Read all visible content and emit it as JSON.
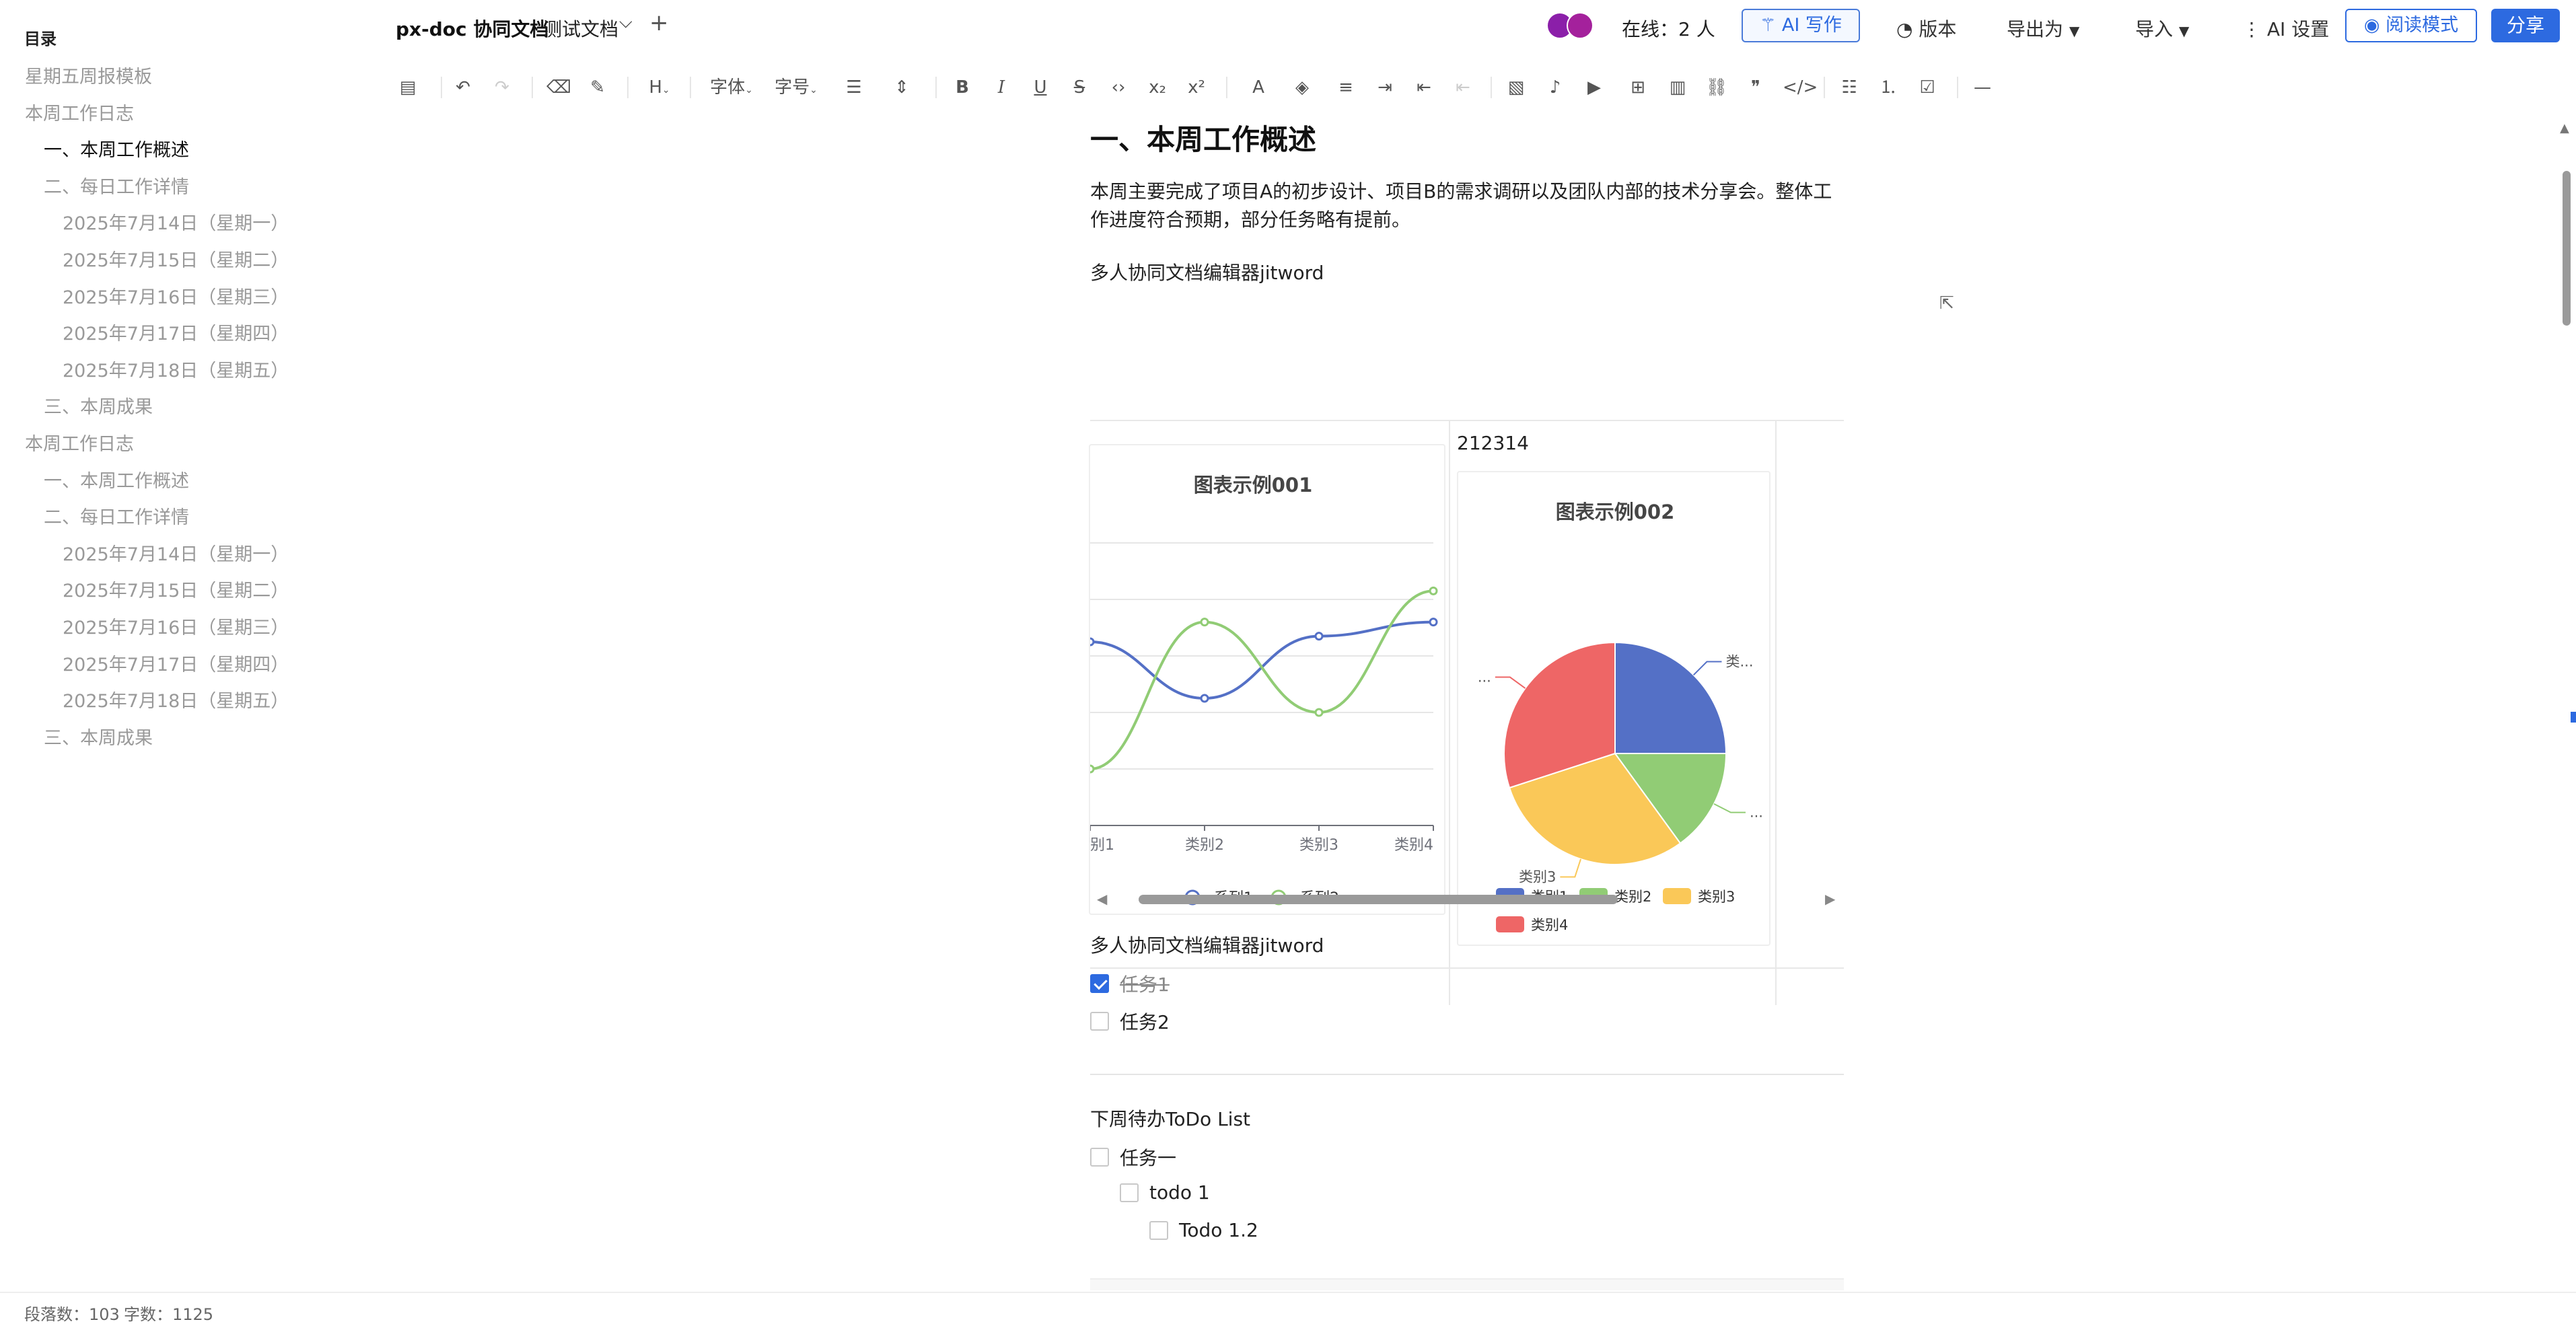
{
  "sidebar": {
    "title": "目录",
    "items": [
      {
        "label": "星期五周报模板",
        "level": 1,
        "active": false
      },
      {
        "label": "本周工作日志",
        "level": 1,
        "active": false
      },
      {
        "label": "一、本周工作概述",
        "level": 2,
        "active": true
      },
      {
        "label": "二、每日工作详情",
        "level": 2,
        "active": false
      },
      {
        "label": "2025年7月14日（星期一）",
        "level": 3,
        "active": false
      },
      {
        "label": "2025年7月15日（星期二）",
        "level": 3,
        "active": false
      },
      {
        "label": "2025年7月16日（星期三）",
        "level": 3,
        "active": false
      },
      {
        "label": "2025年7月17日（星期四）",
        "level": 3,
        "active": false
      },
      {
        "label": "2025年7月18日（星期五）",
        "level": 3,
        "active": false
      },
      {
        "label": "三、本周成果",
        "level": 2,
        "active": false
      },
      {
        "label": "本周工作日志",
        "level": 1,
        "active": false
      },
      {
        "label": "一、本周工作概述",
        "level": 2,
        "active": false
      },
      {
        "label": "二、每日工作详情",
        "level": 2,
        "active": false
      },
      {
        "label": "2025年7月14日（星期一）",
        "level": 3,
        "active": false
      },
      {
        "label": "2025年7月15日（星期二）",
        "level": 3,
        "active": false
      },
      {
        "label": "2025年7月16日（星期三）",
        "level": 3,
        "active": false
      },
      {
        "label": "2025年7月17日（星期四）",
        "level": 3,
        "active": false
      },
      {
        "label": "2025年7月18日（星期五）",
        "level": 3,
        "active": false
      },
      {
        "label": "三、本周成果",
        "level": 2,
        "active": false
      }
    ]
  },
  "header": {
    "brand": "px-doc 协同文档",
    "doc_title": "测试文档",
    "online": "在线：2 人",
    "ai_write": "AI 写作",
    "version": "版本",
    "export": "导出为",
    "import": "导入",
    "ai_settings": "AI 设置",
    "read_mode": "阅读模式",
    "share": "分享"
  },
  "toolbar": {
    "font": "字体",
    "font_size": "字号",
    "heading": "H"
  },
  "doc": {
    "heading": "一、本周工作概述",
    "paragraph": "本周主要完成了项目A的初步设计、项目B的需求调研以及团队内部的技术分享会。整体工作进度符合预期，部分任务略有提前。",
    "editor_line_1": "多人协同文档编辑器jitword",
    "cell_text": "212314",
    "editor_line_2": "多人协同文档编辑器jitword",
    "tasks": [
      {
        "label": "任务1",
        "checked": true
      },
      {
        "label": "任务2",
        "checked": false
      }
    ],
    "todo_heading": "下周待办ToDo List",
    "todos": [
      {
        "label": "任务一",
        "indent": 0
      },
      {
        "label": "todo 1",
        "indent": 1
      },
      {
        "label": "Todo 1.2",
        "indent": 2
      }
    ]
  },
  "chart_data": [
    {
      "type": "line",
      "title": "图表示例001",
      "categories": [
        "类别1",
        "类别2",
        "类别3",
        "类别4"
      ],
      "x_tick_labels_visible": [
        "别1",
        "类别2",
        "类别3",
        "类别4"
      ],
      "series": [
        {
          "name": "系列1",
          "values": [
            65,
            45,
            67,
            72
          ],
          "color": "#5470c6"
        },
        {
          "name": "系列2",
          "values": [
            20,
            72,
            40,
            83
          ],
          "color": "#91cc75"
        }
      ],
      "legend": "bottom",
      "grid": true,
      "smooth": true
    },
    {
      "type": "pie",
      "title": "图表示例002",
      "categories": [
        "类别1",
        "类别2",
        "类别3",
        "类别4"
      ],
      "values": [
        25,
        15,
        30,
        30
      ],
      "colors": [
        "#5470c6",
        "#91cc75",
        "#fac858",
        "#ee6666"
      ],
      "slice_labels": [
        "类...",
        "...",
        "类别3",
        "..."
      ],
      "legend": "bottom"
    }
  ],
  "statusbar": {
    "paragraphs": "段落数：103",
    "words": "字数：1125"
  }
}
